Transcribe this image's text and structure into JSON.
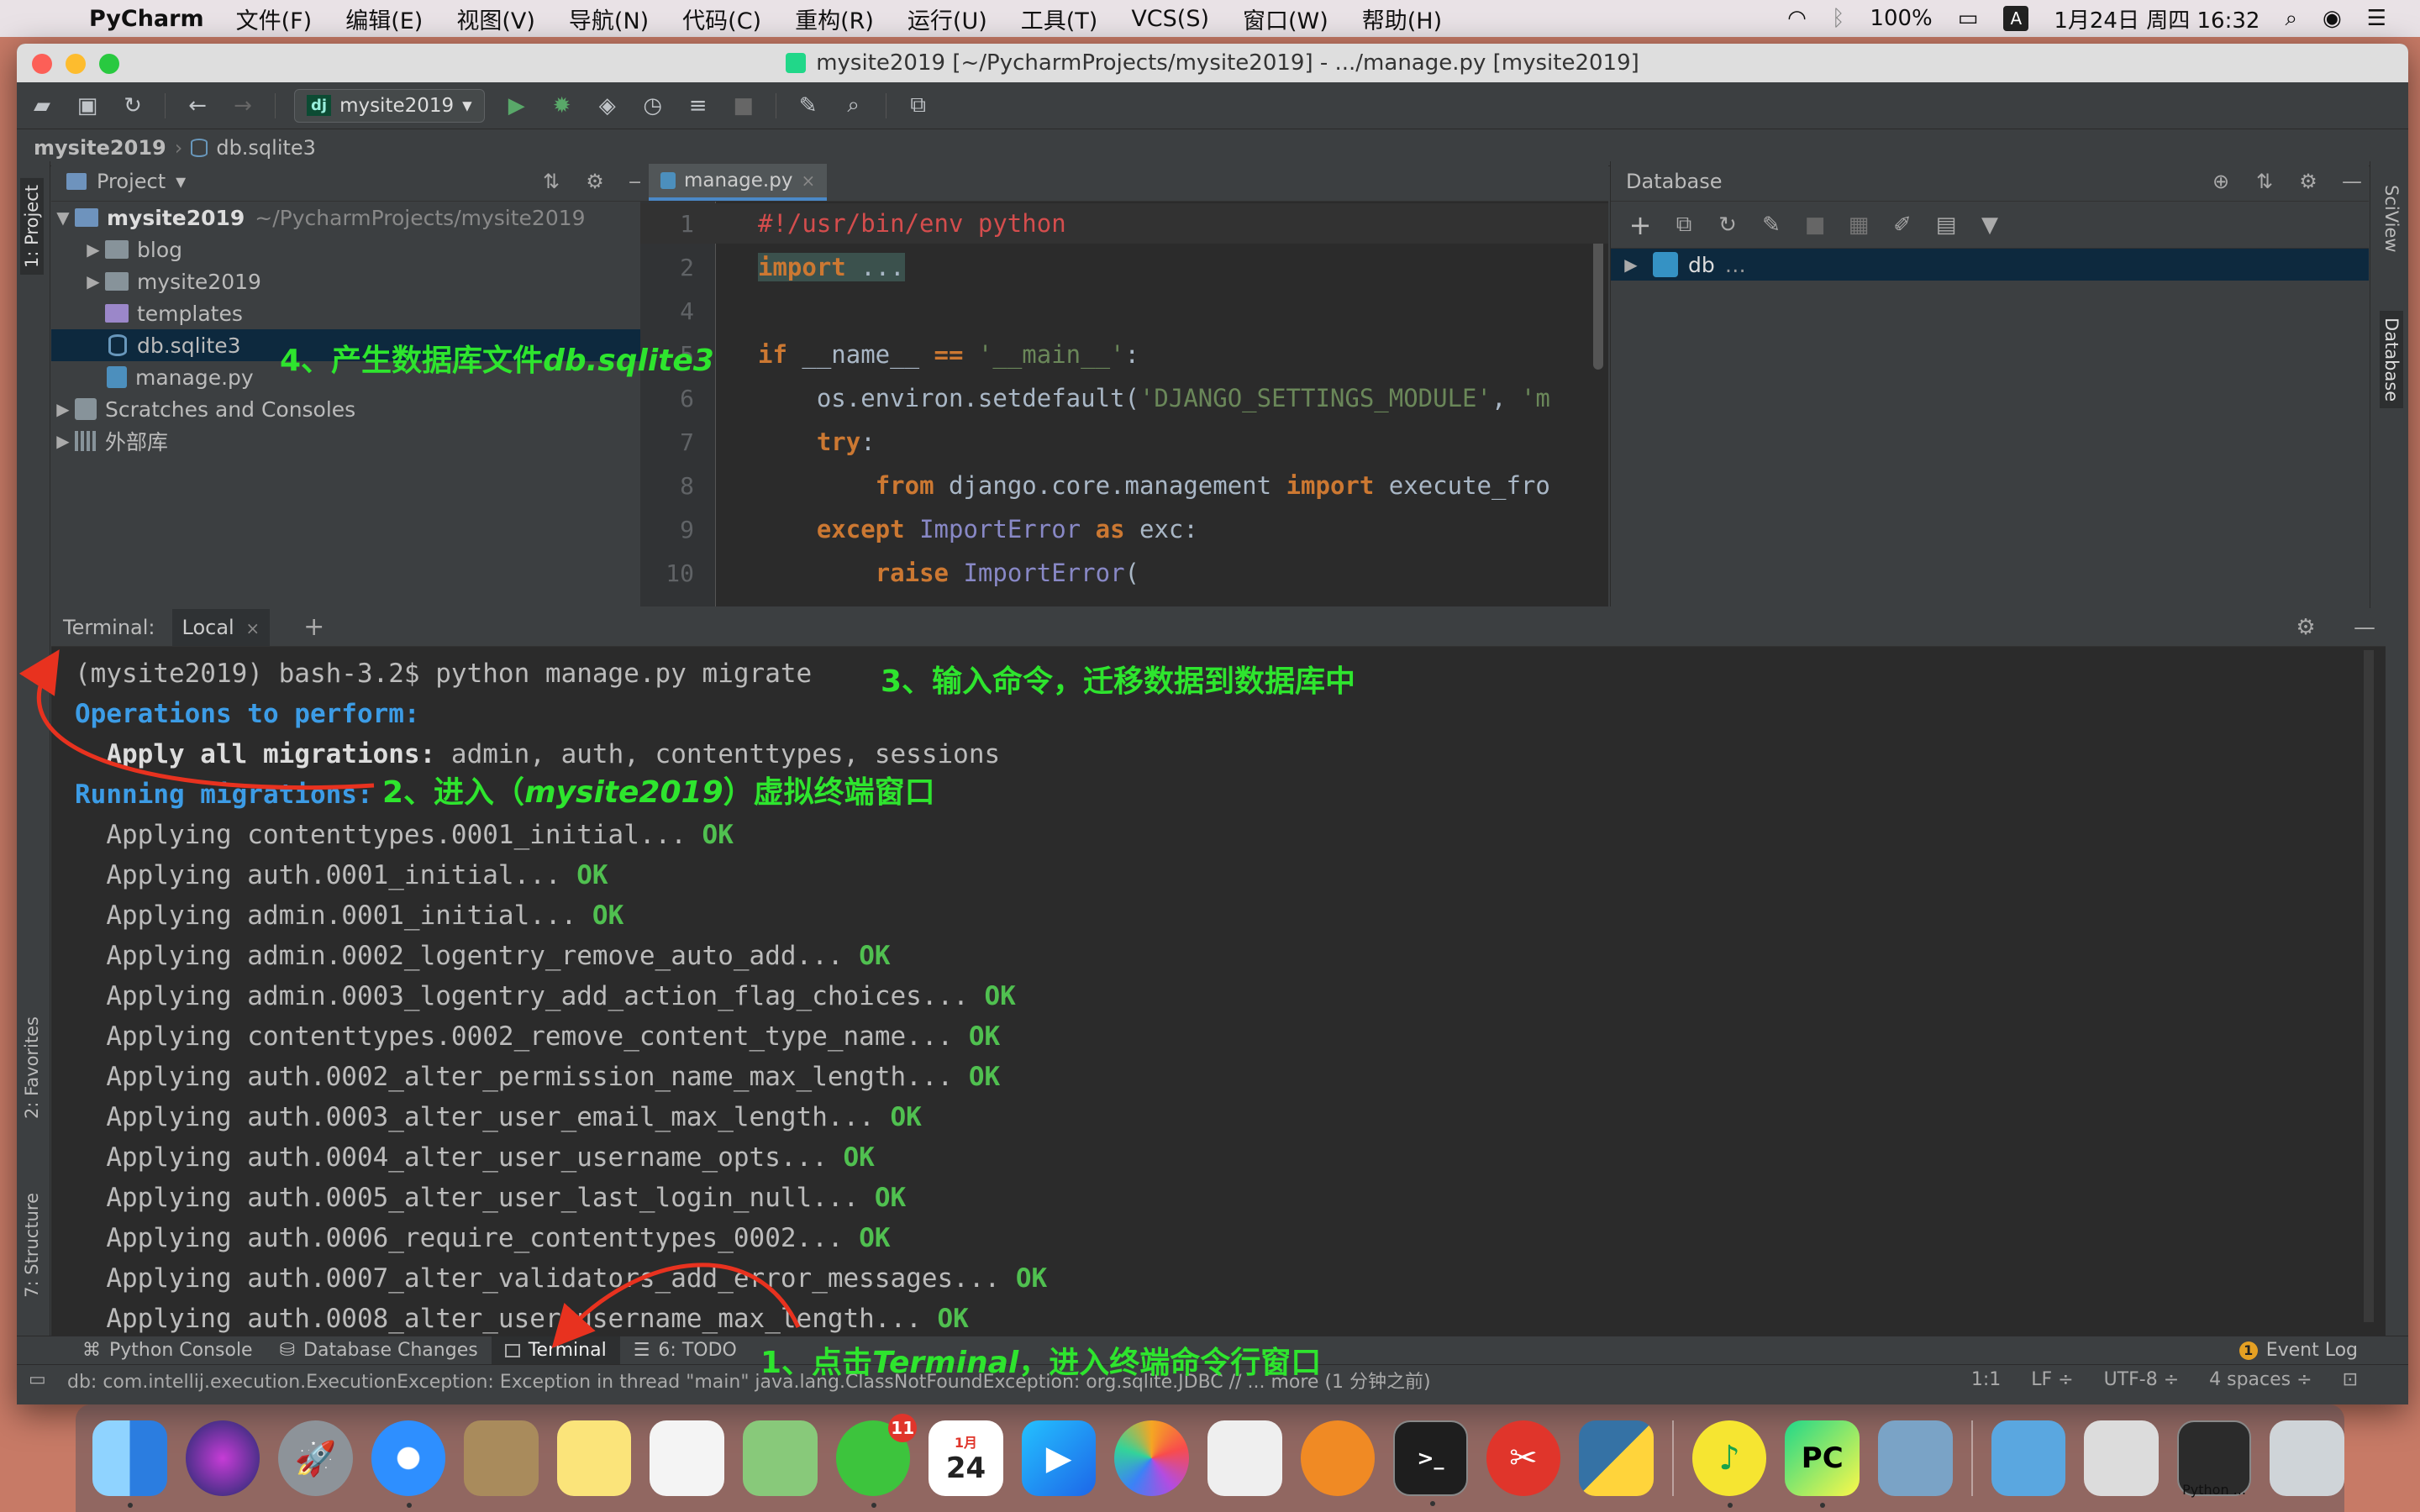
{
  "menubar": {
    "app_name": "PyCharm",
    "items": [
      "文件(F)",
      "编辑(E)",
      "视图(V)",
      "导航(N)",
      "代码(C)",
      "重构(R)",
      "运行(U)",
      "工具(T)",
      "VCS(S)",
      "窗口(W)",
      "帮助(H)"
    ],
    "battery": "100%",
    "input_method": "A",
    "datetime": "1月24日 周四 16:32"
  },
  "window": {
    "title": "mysite2019 [~/PycharmProjects/mysite2019] - .../manage.py [mysite2019]"
  },
  "toolbar": {
    "run_config": "mysite2019",
    "dj_badge": "dj"
  },
  "navbar": {
    "project": "mysite2019",
    "file": "db.sqlite3"
  },
  "project_panel": {
    "title": "Project",
    "root": "mysite2019",
    "root_path": "~/PycharmProjects/mysite2019",
    "items": [
      "blog",
      "mysite2019",
      "templates",
      "db.sqlite3",
      "manage.py"
    ],
    "scratches": "Scratches and Consoles",
    "external_libs": "外部库"
  },
  "editor": {
    "tab": "manage.py",
    "lines": [
      {
        "no": "1",
        "parts": [
          [
            "shebang",
            "#!/usr/bin/env python"
          ]
        ]
      },
      {
        "no": "2",
        "parts": [
          [
            "kw fold-box",
            "import"
          ],
          [
            "fold-box",
            " ..."
          ]
        ]
      },
      {
        "no": "4",
        "parts": []
      },
      {
        "no": "5",
        "parts": [
          [
            "kw",
            "if"
          ],
          [
            "",
            " __name__ "
          ],
          [
            "kw",
            "=="
          ],
          [
            "",
            " "
          ],
          [
            "str",
            "'__main__'"
          ],
          [
            "",
            ":"
          ]
        ]
      },
      {
        "no": "6",
        "parts": [
          [
            "",
            "    os.environ.setdefault("
          ],
          [
            "str",
            "'DJANGO_SETTINGS_MODULE'"
          ],
          [
            "",
            ", "
          ],
          [
            "str",
            "'m"
          ]
        ]
      },
      {
        "no": "7",
        "parts": [
          [
            "",
            "    "
          ],
          [
            "kw",
            "try"
          ],
          [
            "",
            ":"
          ]
        ]
      },
      {
        "no": "8",
        "parts": [
          [
            "",
            "        "
          ],
          [
            "kw",
            "from"
          ],
          [
            "",
            " django.core.management "
          ],
          [
            "kw",
            "import"
          ],
          [
            "",
            " execute_fro"
          ]
        ]
      },
      {
        "no": "9",
        "parts": [
          [
            "",
            "    "
          ],
          [
            "kw",
            "except"
          ],
          [
            "",
            " "
          ],
          [
            "cls",
            "ImportError"
          ],
          [
            "",
            " "
          ],
          [
            "kw",
            "as"
          ],
          [
            "",
            " exc:"
          ]
        ]
      },
      {
        "no": "10",
        "parts": [
          [
            "",
            "        "
          ],
          [
            "kw",
            "raise"
          ],
          [
            "",
            " "
          ],
          [
            "cls",
            "ImportError"
          ],
          [
            "",
            "("
          ]
        ]
      }
    ]
  },
  "database_panel": {
    "title": "Database",
    "root_item": "db",
    "root_suffix": "…"
  },
  "side_tabs": {
    "project": "1: Project",
    "favorites": "2: Favorites",
    "structure": "7: Structure",
    "sciview": "SciView",
    "database": "Database"
  },
  "terminal": {
    "label": "Terminal:",
    "tab": "Local",
    "lines": [
      [
        [
          "",
          "(mysite2019) bash-3.2$ python manage.py migrate"
        ]
      ],
      [
        [
          "t-blue",
          "Operations to perform:"
        ]
      ],
      [
        [
          "t-bold",
          "  Apply all migrations:"
        ],
        [
          "",
          " admin, auth, contenttypes, sessions"
        ]
      ],
      [
        [
          "t-blue",
          "Running migrations:"
        ]
      ],
      [
        [
          "",
          "  Applying contenttypes.0001_initial... "
        ],
        [
          "ok",
          "OK"
        ]
      ],
      [
        [
          "",
          "  Applying auth.0001_initial... "
        ],
        [
          "ok",
          "OK"
        ]
      ],
      [
        [
          "",
          "  Applying admin.0001_initial... "
        ],
        [
          "ok",
          "OK"
        ]
      ],
      [
        [
          "",
          "  Applying admin.0002_logentry_remove_auto_add... "
        ],
        [
          "ok",
          "OK"
        ]
      ],
      [
        [
          "",
          "  Applying admin.0003_logentry_add_action_flag_choices... "
        ],
        [
          "ok",
          "OK"
        ]
      ],
      [
        [
          "",
          "  Applying contenttypes.0002_remove_content_type_name... "
        ],
        [
          "ok",
          "OK"
        ]
      ],
      [
        [
          "",
          "  Applying auth.0002_alter_permission_name_max_length... "
        ],
        [
          "ok",
          "OK"
        ]
      ],
      [
        [
          "",
          "  Applying auth.0003_alter_user_email_max_length... "
        ],
        [
          "ok",
          "OK"
        ]
      ],
      [
        [
          "",
          "  Applying auth.0004_alter_user_username_opts... "
        ],
        [
          "ok",
          "OK"
        ]
      ],
      [
        [
          "",
          "  Applying auth.0005_alter_user_last_login_null... "
        ],
        [
          "ok",
          "OK"
        ]
      ],
      [
        [
          "",
          "  Applying auth.0006_require_contenttypes_0002... "
        ],
        [
          "ok",
          "OK"
        ]
      ],
      [
        [
          "",
          "  Applying auth.0007_alter_validators_add_error_messages... "
        ],
        [
          "ok",
          "OK"
        ]
      ],
      [
        [
          "",
          "  Applying auth.0008_alter_user_username_max_length... "
        ],
        [
          "ok",
          "OK"
        ]
      ]
    ]
  },
  "bottom_tabs": {
    "python_console": "Python Console",
    "database_changes": "Database Changes",
    "terminal": "Terminal",
    "todo": "6: TODO",
    "event_log": "Event Log",
    "event_count": "1"
  },
  "statusbar": {
    "message": "db: com.intellij.execution.ExecutionException: Exception in thread \"main\" java.lang.ClassNotFoundException: org.sqlite.JDBC // ... more (1 分钟之前)",
    "position": "1:1",
    "line_sep": "LF ÷",
    "encoding": "UTF-8 ÷",
    "indent": "4 spaces ÷"
  },
  "annotations": {
    "a1_prefix": "1、点击",
    "a1_em": "Terminal",
    "a1_suffix": "，进入终端命令行窗口",
    "a2_prefix": "2、进入（",
    "a2_em": "mysite2019",
    "a2_suffix": "）虚拟终端窗口",
    "a3": "3、输入命令，迁移数据到数据库中",
    "a4_prefix": "4、产生数据库文件",
    "a4_em": "db.sqlite3"
  },
  "dock": {
    "wechat_badge": "11",
    "calendar_day": "24",
    "calendar_month": "1月",
    "python_label": "Python ..."
  },
  "colors": {
    "annotation": "#2ee52e",
    "arrow": "#e8321f",
    "ok": "#50c050",
    "terminal_heading": "#3c9ce6"
  }
}
